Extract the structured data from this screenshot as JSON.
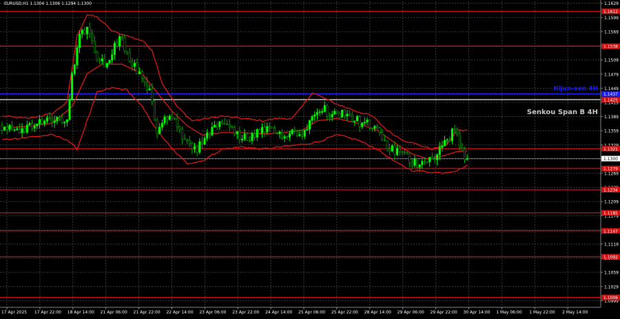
{
  "window": {
    "symbol_info": "EURUSD,H1  1.1304 1.1306 1.1294 1.1300"
  },
  "chart_data": {
    "type": "candlestick",
    "symbol": "EURUSD",
    "timeframe": "H1",
    "ylim": [
      1.0985,
      1.1633
    ],
    "y_ticks": [
      "1.1629",
      "1.1599",
      "1.1569",
      "1.1539",
      "1.1509",
      "1.1479",
      "1.1449",
      "1.1419",
      "1.1389",
      "1.1359",
      "1.1329",
      "1.1299",
      "1.1269",
      "1.1239",
      "1.1209",
      "1.1179",
      "1.1149",
      "1.1119",
      "1.1089",
      "1.1059",
      "1.1029",
      "1.0999"
    ],
    "x_ticks": [
      "17 Apr 2025",
      "17 Apr 22:00",
      "18 Apr 14:00",
      "21 Apr 06:00",
      "21 Apr 22:00",
      "22 Apr 14:00",
      "23 Apr 06:00",
      "23 Apr 22:00",
      "24 Apr 14:00",
      "25 Apr 06:00",
      "25 Apr 22:00",
      "28 Apr 14:00",
      "29 Apr 06:00",
      "29 Apr 22:00",
      "30 Apr 14:00",
      "1 May 06:00",
      "1 May 22:00",
      "2 May 14:00"
    ],
    "current_price": 1.13,
    "current_price_label": "1.1300",
    "colors": {
      "background": "#000000",
      "grid": "#3c3c3c",
      "bull": "#00ff00",
      "bear": "#00aa00",
      "level": "#d01010",
      "indicator": "#e01818",
      "kijun": "#1a1aff",
      "senkou": "#c8c8c8",
      "axis_text": "#ffffff"
    },
    "levels": [
      {
        "price": 1.1612,
        "label": "1.1612"
      },
      {
        "price": 1.1538,
        "label": "1.1538"
      },
      {
        "price": 1.1321,
        "label": "1.1321"
      },
      {
        "price": 1.1279,
        "label": "1.1279"
      },
      {
        "price": 1.1234,
        "label": "1.1234"
      },
      {
        "price": 1.1185,
        "label": "1.1185"
      },
      {
        "price": 1.1147,
        "label": "1.1147"
      },
      {
        "price": 1.1092,
        "label": "1.1092"
      },
      {
        "price": 1.1006,
        "label": "1.1006"
      }
    ],
    "kijun": {
      "price": 1.1437,
      "label": "Kijun-sen 4H",
      "tag": "1.1437"
    },
    "senkou": {
      "price": 1.1425,
      "label": "Senkou Span B 4H",
      "tag": "1.1425"
    },
    "candle_count": 192,
    "close_path": [
      [
        0,
        1.137
      ],
      [
        6,
        1.1365
      ],
      [
        10,
        1.1362
      ],
      [
        14,
        1.1373
      ],
      [
        18,
        1.138
      ],
      [
        22,
        1.1378
      ],
      [
        26,
        1.139
      ],
      [
        28,
        1.147
      ],
      [
        31,
        1.156
      ],
      [
        34,
        1.158
      ],
      [
        38,
        1.152
      ],
      [
        42,
        1.15
      ],
      [
        47,
        1.156
      ],
      [
        51,
        1.151
      ],
      [
        55,
        1.148
      ],
      [
        59,
        1.144
      ],
      [
        62,
        1.136
      ],
      [
        65,
        1.139
      ],
      [
        69,
        1.138
      ],
      [
        73,
        1.133
      ],
      [
        78,
        1.132
      ],
      [
        83,
        1.135
      ],
      [
        87,
        1.138
      ],
      [
        92,
        1.136
      ],
      [
        96,
        1.134
      ],
      [
        101,
        1.135
      ],
      [
        106,
        1.136
      ],
      [
        111,
        1.135
      ],
      [
        116,
        1.136
      ],
      [
        120,
        1.1345
      ],
      [
        124,
        1.14
      ],
      [
        128,
        1.141
      ],
      [
        132,
        1.139
      ],
      [
        137,
        1.14
      ],
      [
        142,
        1.138
      ],
      [
        147,
        1.137
      ],
      [
        151,
        1.135
      ],
      [
        155,
        1.132
      ],
      [
        160,
        1.131
      ],
      [
        165,
        1.129
      ],
      [
        170,
        1.13
      ],
      [
        174,
        1.131
      ],
      [
        178,
        1.134
      ],
      [
        181,
        1.136
      ],
      [
        184,
        1.131
      ],
      [
        186,
        1.13
      ]
    ],
    "bands": {
      "upper": [
        [
          0,
          1.139
        ],
        [
          10,
          1.1385
        ],
        [
          20,
          1.1395
        ],
        [
          26,
          1.142
        ],
        [
          30,
          1.156
        ],
        [
          34,
          1.1605
        ],
        [
          38,
          1.16
        ],
        [
          44,
          1.157
        ],
        [
          50,
          1.156
        ],
        [
          56,
          1.155
        ],
        [
          60,
          1.153
        ],
        [
          64,
          1.146
        ],
        [
          70,
          1.141
        ],
        [
          76,
          1.138
        ],
        [
          82,
          1.1385
        ],
        [
          88,
          1.139
        ],
        [
          96,
          1.1385
        ],
        [
          104,
          1.138
        ],
        [
          110,
          1.1385
        ],
        [
          116,
          1.1385
        ],
        [
          120,
          1.141
        ],
        [
          124,
          1.144
        ],
        [
          128,
          1.143
        ],
        [
          134,
          1.1415
        ],
        [
          142,
          1.14
        ],
        [
          148,
          1.139
        ],
        [
          154,
          1.136
        ],
        [
          160,
          1.134
        ],
        [
          166,
          1.133
        ],
        [
          172,
          1.132
        ],
        [
          178,
          1.133
        ],
        [
          182,
          1.136
        ],
        [
          186,
          1.136
        ]
      ],
      "middle": [
        [
          0,
          1.1365
        ],
        [
          10,
          1.1368
        ],
        [
          20,
          1.1375
        ],
        [
          28,
          1.141
        ],
        [
          34,
          1.148
        ],
        [
          40,
          1.15
        ],
        [
          48,
          1.15
        ],
        [
          56,
          1.148
        ],
        [
          62,
          1.144
        ],
        [
          68,
          1.14
        ],
        [
          74,
          1.137
        ],
        [
          80,
          1.135
        ],
        [
          88,
          1.1355
        ],
        [
          96,
          1.1355
        ],
        [
          104,
          1.1352
        ],
        [
          112,
          1.1355
        ],
        [
          120,
          1.136
        ],
        [
          126,
          1.138
        ],
        [
          134,
          1.1385
        ],
        [
          142,
          1.1375
        ],
        [
          150,
          1.136
        ],
        [
          158,
          1.133
        ],
        [
          164,
          1.131
        ],
        [
          170,
          1.13
        ],
        [
          176,
          1.1305
        ],
        [
          182,
          1.1315
        ],
        [
          186,
          1.1316
        ]
      ],
      "lower": [
        [
          0,
          1.134
        ],
        [
          10,
          1.1345
        ],
        [
          20,
          1.135
        ],
        [
          26,
          1.134
        ],
        [
          30,
          1.132
        ],
        [
          34,
          1.138
        ],
        [
          38,
          1.144
        ],
        [
          44,
          1.145
        ],
        [
          50,
          1.1445
        ],
        [
          56,
          1.141
        ],
        [
          62,
          1.136
        ],
        [
          68,
          1.132
        ],
        [
          74,
          1.129
        ],
        [
          80,
          1.1295
        ],
        [
          88,
          1.132
        ],
        [
          96,
          1.1325
        ],
        [
          104,
          1.132
        ],
        [
          112,
          1.1325
        ],
        [
          120,
          1.133
        ],
        [
          126,
          1.1335
        ],
        [
          134,
          1.135
        ],
        [
          142,
          1.134
        ],
        [
          150,
          1.132
        ],
        [
          158,
          1.129
        ],
        [
          164,
          1.1275
        ],
        [
          170,
          1.1272
        ],
        [
          176,
          1.127
        ],
        [
          182,
          1.1275
        ],
        [
          186,
          1.1285
        ]
      ]
    }
  }
}
